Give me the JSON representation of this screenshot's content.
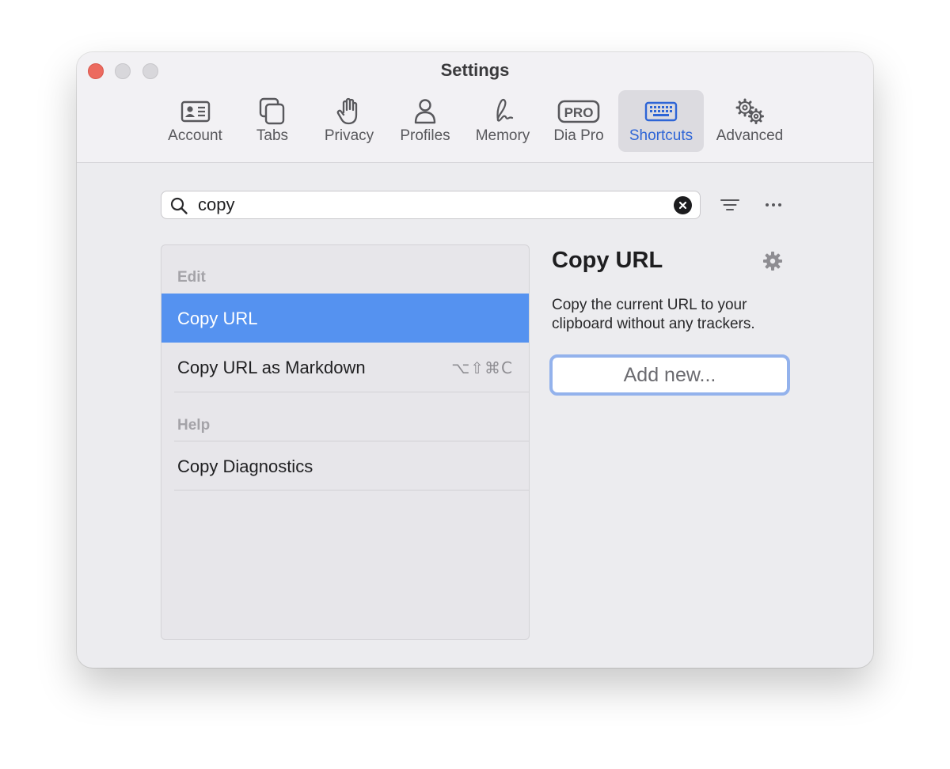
{
  "window": {
    "title": "Settings"
  },
  "tabs": [
    {
      "label": "Account",
      "icon": "contact-card-icon"
    },
    {
      "label": "Tabs",
      "icon": "tabs-icon"
    },
    {
      "label": "Privacy",
      "icon": "hand-icon"
    },
    {
      "label": "Profiles",
      "icon": "person-icon"
    },
    {
      "label": "Memory",
      "icon": "signature-icon"
    },
    {
      "label": "Dia Pro",
      "icon": "pro-badge-icon",
      "badge": "PRO"
    },
    {
      "label": "Shortcuts",
      "icon": "keyboard-icon",
      "active": true
    },
    {
      "label": "Advanced",
      "icon": "gears-icon"
    }
  ],
  "search": {
    "value": "copy"
  },
  "list": {
    "sections": [
      {
        "title": "Edit",
        "items": [
          {
            "label": "Copy URL",
            "shortcut": "",
            "selected": true
          },
          {
            "label": "Copy URL as Markdown",
            "shortcut": "⌥⇧⌘C",
            "selected": false
          }
        ]
      },
      {
        "title": "Help",
        "items": [
          {
            "label": "Copy Diagnostics",
            "shortcut": "",
            "selected": false
          }
        ]
      }
    ]
  },
  "detail": {
    "title": "Copy URL",
    "description": "Copy the current URL to your clipboard without any trackers.",
    "add_button": "Add new..."
  },
  "colors": {
    "accent": "#2e65d6",
    "selection": "#5592f0",
    "close": "#ec6a5f",
    "focus_ring": "#93b2ec"
  }
}
